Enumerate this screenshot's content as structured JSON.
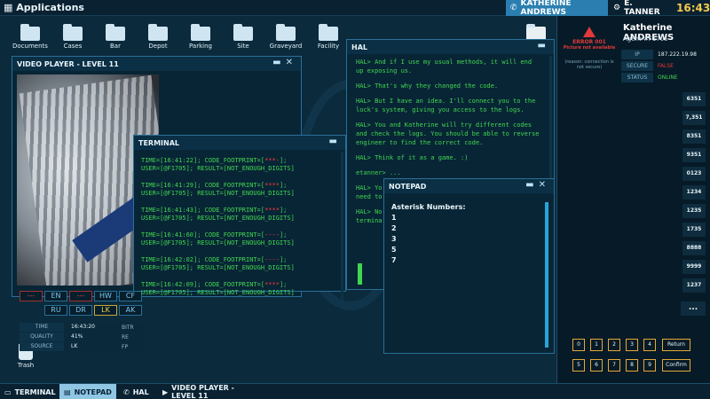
{
  "topbar": {
    "apps_label": "Applications",
    "user1": "KATHERINE ANDREWS",
    "user2": "E. TANNER",
    "clock": "16:43"
  },
  "desktop_icons": [
    "Documents",
    "Cases",
    "Bar",
    "Depot",
    "Parking",
    "Site",
    "Graveyard",
    "Facility"
  ],
  "trash_label": "Trash",
  "video": {
    "title": "VIDEO PLAYER - LEVEL 11",
    "keys": [
      {
        "label": "---",
        "style": "red"
      },
      {
        "label": "EN",
        "style": "blue"
      },
      {
        "label": "---",
        "style": "red"
      },
      {
        "label": "HW",
        "style": "blue"
      },
      {
        "label": "CF",
        "style": "blue"
      },
      {
        "label": "RU",
        "style": "blue"
      },
      {
        "label": "DR",
        "style": "blue"
      },
      {
        "label": "LK",
        "style": "yellow"
      },
      {
        "label": "AK",
        "style": "blue"
      }
    ],
    "stats": [
      {
        "k": "TIME",
        "v": "16:43:20"
      },
      {
        "k": "QUALITY",
        "v": "41%"
      },
      {
        "k": "SOURCE",
        "v": "LK"
      }
    ],
    "side_labels": [
      "BITR",
      "RE",
      "FP"
    ]
  },
  "terminal": {
    "title": "TERMINAL",
    "entries": [
      {
        "prefix": "TIME=[16:41:22]; CODE_FOOTPRINT=[",
        "code": "***-",
        "suffix": "];",
        "line2": "USER=[@F1705]; RESULT=[NOT_ENOUGH_DIGITS]"
      },
      {
        "prefix": "TIME=[16:41:29]; CODE_FOOTPRINT=[",
        "code": "****",
        "suffix": "];",
        "line2": "USER=[@F1705]; RESULT=[NOT_ENOUGH_DIGITS]"
      },
      {
        "prefix": "TIME=[16:41:43]; CODE_FOOTPRINT=[",
        "code": "****",
        "suffix": "];",
        "line2": "USER=[@F1705]; RESULT=[NOT_ENOUGH_DIGITS]"
      },
      {
        "prefix": "TIME=[16:41:60]; CODE_FOOTPRINT=[",
        "code": "----",
        "suffix": "];",
        "line2": "USER=[@F1705]; RESULT=[NOT_ENOUGH_DIGITS]"
      },
      {
        "prefix": "TIME=[16:42:02]; CODE_FOOTPRINT=[",
        "code": "----",
        "suffix": "];",
        "line2": "USER=[@F1705]; RESULT=[NOT_ENOUGH_DIGITS]"
      },
      {
        "prefix": "TIME=[16:42:09]; CODE_FOOTPRINT=[",
        "code": "****",
        "suffix": "];",
        "line2": "USER=[@F1705]; RESULT=[NOT_ENOUGH_DIGITS]"
      }
    ]
  },
  "hal": {
    "title": "HAL",
    "messages": [
      "HAL> And if I use my usual methods, it will end up exposing us.",
      "HAL> That's why they changed the code.",
      "HAL> But I have an idea. I'll connect you to the lock's system, giving you access to the logs.",
      "HAL> You and Katherine will try different codes and check the logs. You should be able to reverse engineer to find the correct code.",
      "HAL> Think of it as a game. :)",
      "etanner> ...",
      "HAL> Yo",
      "need to",
      "HAL> No",
      "termina"
    ]
  },
  "notepad": {
    "title": "NOTEPAD",
    "lines": [
      "Asterisk Numbers:",
      "1",
      "2",
      "3",
      "5",
      "7"
    ]
  },
  "rpanel": {
    "error_title": "ERROR 001",
    "error_sub": "Picture not available",
    "error_reason": "(reason: connection is not secure)",
    "agent_name": "Katherine ANDREWS",
    "agent_id": "Agent #F1705",
    "info": [
      {
        "k": "IP",
        "v": "187.222.19.98",
        "color": "#e8f4fa"
      },
      {
        "k": "SECURE",
        "v": "FALSE",
        "color": "#e03a3a"
      },
      {
        "k": "STATUS",
        "v": "ONLINE",
        "color": "#42d64f"
      }
    ],
    "numbers": [
      "6351",
      "7,351",
      "8351",
      "9351",
      "0123",
      "1234",
      "1235",
      "1735",
      "8888",
      "9999",
      "1237"
    ],
    "more_label": "...",
    "keypad_row1": [
      "0",
      "1",
      "2",
      "3",
      "4"
    ],
    "keypad_row2": [
      "5",
      "6",
      "7",
      "8",
      "9"
    ],
    "return_label": "Return",
    "confirm_label": "Confirm"
  },
  "taskbar": {
    "items": [
      {
        "label": "TERMINAL",
        "icon": "terminal-icon"
      },
      {
        "label": "NOTEPAD",
        "icon": "notepad-icon"
      },
      {
        "label": "HAL",
        "icon": "phone-icon"
      },
      {
        "label": "VIDEO PLAYER - LEVEL 11",
        "icon": "video-icon"
      }
    ],
    "active_index": 1
  },
  "colors": {
    "accent": "#2a7fb0",
    "terminal_green": "#42d64f",
    "error_red": "#e03a3a",
    "clock_yellow": "#f2c94c",
    "keypad_border": "#e3a93a"
  }
}
